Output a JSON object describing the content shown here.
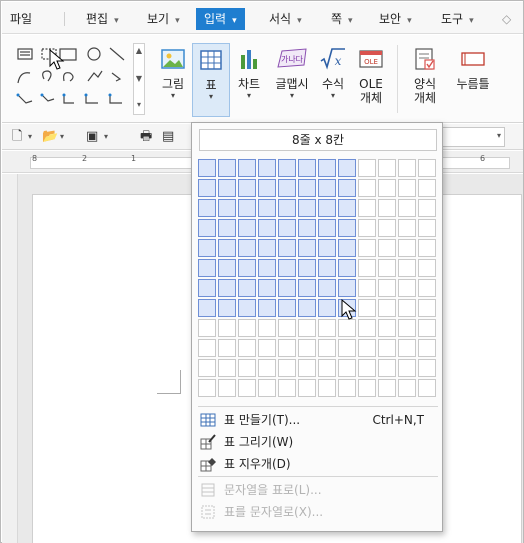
{
  "menu": {
    "items": [
      {
        "label": "파일"
      },
      {
        "label": "편집"
      },
      {
        "label": "보기"
      },
      {
        "label": "입력"
      },
      {
        "label": "서식"
      },
      {
        "label": "쪽"
      },
      {
        "label": "보안"
      },
      {
        "label": "도구"
      }
    ],
    "active": "입력"
  },
  "ribbon": {
    "picture_label": "그림",
    "table_label": "표",
    "chart_label": "차트",
    "wordart_label": "글맵시",
    "formula_label": "수식",
    "ole_label_1": "OLE",
    "ole_label_2": "개체",
    "form_label_1": "양식",
    "form_label_2": "개체",
    "button_label": "누름틀",
    "ole_icon_text": "OLE",
    "wordart_icon_text": "가나다"
  },
  "ruler": {
    "labels": [
      "8",
      "2",
      "1",
      "6"
    ]
  },
  "table_popup": {
    "size_text": "8줄 x 8칸",
    "rows_selected": 8,
    "cols_selected": 8,
    "grid_rows": 12,
    "grid_cols": 12,
    "items": [
      {
        "label": "표 만들기(T)...",
        "shortcut": "Ctrl+N,T",
        "icon": "table-icon",
        "enabled": true
      },
      {
        "label": "표 그리기(W)",
        "shortcut": "",
        "icon": "draw-table-icon",
        "enabled": true
      },
      {
        "label": "표 지우개(D)",
        "shortcut": "",
        "icon": "eraser-table-icon",
        "enabled": true
      },
      {
        "label": "문자열을 표로(L)...",
        "shortcut": "",
        "icon": "text-to-table-icon",
        "enabled": false
      },
      {
        "label": "표를 문자열로(X)...",
        "shortcut": "",
        "icon": "table-to-text-icon",
        "enabled": false
      }
    ]
  },
  "colors": {
    "accent": "#1f7ed0",
    "selected_cell_fill": "#dce6fa",
    "selected_cell_border": "#6f8fd6"
  }
}
